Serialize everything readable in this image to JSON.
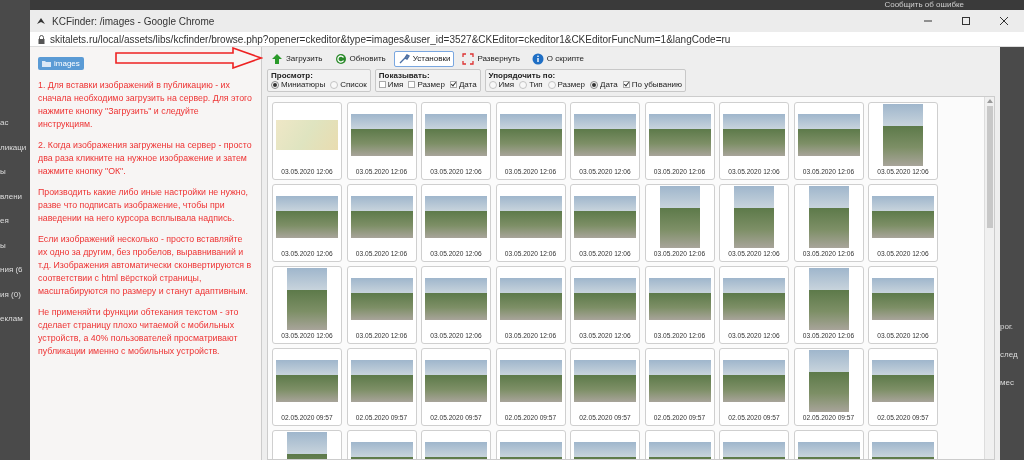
{
  "background_page": {
    "notice": "Сообщить об ошибке",
    "left_fragments": [
      "ас",
      "ликаци",
      "ы",
      "влени",
      "ея",
      "ы",
      "ния (6",
      "ия (0)",
      "еклам"
    ],
    "right_fragments": [
      "рог.",
      "след",
      "мес"
    ]
  },
  "window": {
    "title": "KCFinder: /images - Google Chrome",
    "url": "skitalets.ru/local/assets/libs/kcfinder/browse.php?opener=ckeditor&type=images&user_id=3527&CKEditor=ckeditor1&CKEditorFuncNum=1&langCode=ru"
  },
  "sidebar": {
    "folder": "images",
    "paragraphs": [
      "1. Для вставки изображений в публикацию - их сначала необходимо загрузить на сервер. Для этого нажмите кнопку \"Загрузить\" и следуйте инструкциям.",
      "2. Когда изображения загружены на сервер - просто два раза кликните на нужное изображение и затем нажмите кнопку \"ОК\".",
      "Производить какие либо иные настройки не нужно, разве что подписать изображение, чтобы при наведении на него курсора всплывала надпись.",
      "Если изображений несколько - просто вставляйте их одно за другим, без пробелов, выравниваний и т.д. Изображения автоматически сконвертируются в соответствии с html вёрсткой страницы, масштабируются по размеру и станут адаптивным.",
      "Не применяйти функции обтекания текстом - это сделает страницу плохо читаемой с мобильных устройств, а 40% пользователей просматривают публикации именно с мобильных устройств."
    ]
  },
  "toolbar": [
    {
      "kind": "upload",
      "label": "Загрузить",
      "selected": false
    },
    {
      "kind": "refresh",
      "label": "Обновить",
      "selected": false
    },
    {
      "kind": "settings",
      "label": "Установки",
      "selected": true
    },
    {
      "kind": "maximize",
      "label": "Развернуть",
      "selected": false
    },
    {
      "kind": "about",
      "label": "О скрипте",
      "selected": false
    }
  ],
  "settings": [
    {
      "legend": "Просмотр:",
      "options": [
        {
          "kind": "radio",
          "label": "Миниатюры",
          "selected": true
        },
        {
          "kind": "radio",
          "label": "Список",
          "selected": false
        }
      ]
    },
    {
      "legend": "Показывать:",
      "options": [
        {
          "kind": "checkbox",
          "label": "Имя",
          "checked": false
        },
        {
          "kind": "checkbox",
          "label": "Размер",
          "checked": false
        },
        {
          "kind": "checkbox",
          "label": "Дата",
          "checked": true
        }
      ]
    },
    {
      "legend": "Упорядочить по:",
      "options": [
        {
          "kind": "radio",
          "label": "Имя",
          "selected": false
        },
        {
          "kind": "radio",
          "label": "Тип",
          "selected": false
        },
        {
          "kind": "radio",
          "label": "Размер",
          "selected": false
        },
        {
          "kind": "radio",
          "label": "Дата",
          "selected": true
        },
        {
          "kind": "checkbox",
          "label": "По убыванию",
          "checked": true
        }
      ]
    }
  ],
  "thumbnails": [
    {
      "kind": "map",
      "date": "03.05.2020 12:06"
    },
    {
      "kind": "landscape",
      "date": "03.05.2020 12:06"
    },
    {
      "kind": "landscape",
      "date": "03.05.2020 12:06"
    },
    {
      "kind": "landscape",
      "date": "03.05.2020 12:06"
    },
    {
      "kind": "landscape",
      "date": "03.05.2020 12:06"
    },
    {
      "kind": "landscape",
      "date": "03.05.2020 12:06"
    },
    {
      "kind": "landscape",
      "date": "03.05.2020 12:06"
    },
    {
      "kind": "landscape",
      "date": "03.05.2020 12:06"
    },
    {
      "kind": "portrait",
      "date": "03.05.2020 12:06"
    },
    {
      "kind": "landscape",
      "date": "03.05.2020 12:06"
    },
    {
      "kind": "landscape",
      "date": "03.05.2020 12:06"
    },
    {
      "kind": "landscape",
      "date": "03.05.2020 12:06"
    },
    {
      "kind": "landscape",
      "date": "03.05.2020 12:06"
    },
    {
      "kind": "landscape",
      "date": "03.05.2020 12:06"
    },
    {
      "kind": "portrait",
      "date": "03.05.2020 12:06"
    },
    {
      "kind": "portrait",
      "date": "03.05.2020 12:06"
    },
    {
      "kind": "portrait",
      "date": "03.05.2020 12:06"
    },
    {
      "kind": "landscape",
      "date": "03.05.2020 12:06"
    },
    {
      "kind": "portrait",
      "date": "03.05.2020 12:06"
    },
    {
      "kind": "landscape",
      "date": "03.05.2020 12:06"
    },
    {
      "kind": "landscape",
      "date": "03.05.2020 12:06"
    },
    {
      "kind": "landscape",
      "date": "03.05.2020 12:06"
    },
    {
      "kind": "landscape",
      "date": "03.05.2020 12:06"
    },
    {
      "kind": "landscape",
      "date": "03.05.2020 12:06"
    },
    {
      "kind": "landscape",
      "date": "03.05.2020 12:06"
    },
    {
      "kind": "portrait",
      "date": "03.05.2020 12:06"
    },
    {
      "kind": "landscape",
      "date": "03.05.2020 12:06"
    },
    {
      "kind": "landscape",
      "date": "02.05.2020 09:57"
    },
    {
      "kind": "landscape",
      "date": "02.05.2020 09:57"
    },
    {
      "kind": "landscape",
      "date": "02.05.2020 09:57"
    },
    {
      "kind": "landscape",
      "date": "02.05.2020 09:57"
    },
    {
      "kind": "landscape",
      "date": "02.05.2020 09:57"
    },
    {
      "kind": "landscape",
      "date": "02.05.2020 09:57"
    },
    {
      "kind": "landscape",
      "date": "02.05.2020 09:57"
    },
    {
      "kind": "portrait",
      "date": "02.05.2020 09:57"
    },
    {
      "kind": "landscape",
      "date": "02.05.2020 09:57"
    },
    {
      "kind": "portrait"
    },
    {
      "kind": "landscape"
    },
    {
      "kind": "landscape"
    },
    {
      "kind": "landscape"
    },
    {
      "kind": "landscape"
    },
    {
      "kind": "landscape"
    },
    {
      "kind": "landscape"
    },
    {
      "kind": "landscape"
    },
    {
      "kind": "landscape"
    }
  ]
}
